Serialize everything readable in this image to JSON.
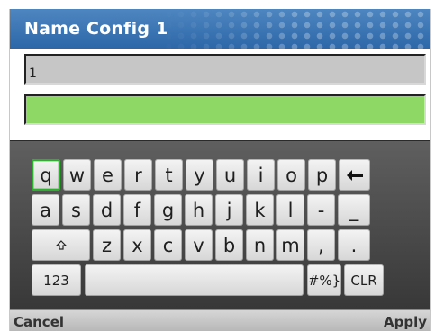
{
  "header": {
    "title": "Name Config 1"
  },
  "fields": {
    "name_value": "1",
    "second_value": ""
  },
  "keyboard": {
    "row1": [
      "q",
      "w",
      "e",
      "r",
      "t",
      "y",
      "u",
      "i",
      "o",
      "p"
    ],
    "row2": [
      "a",
      "s",
      "d",
      "f",
      "g",
      "h",
      "j",
      "k",
      "l",
      "-",
      "_"
    ],
    "row3": [
      "z",
      "x",
      "c",
      "v",
      "b",
      "n",
      "m",
      ",",
      "."
    ],
    "numbers_label": "123",
    "symbols_label": "#%}",
    "clear_label": "CLR",
    "selected_key": "q"
  },
  "softkeys": {
    "left": "Cancel",
    "right": "Apply"
  },
  "colors": {
    "title_bar": "#3a73b2",
    "value_field": "#8ed866",
    "name_field": "#c6c6c6",
    "selection": "#2fae2f"
  },
  "icons": {
    "backspace": "left-arrow-icon",
    "shift": "shift-arrow-icon"
  }
}
